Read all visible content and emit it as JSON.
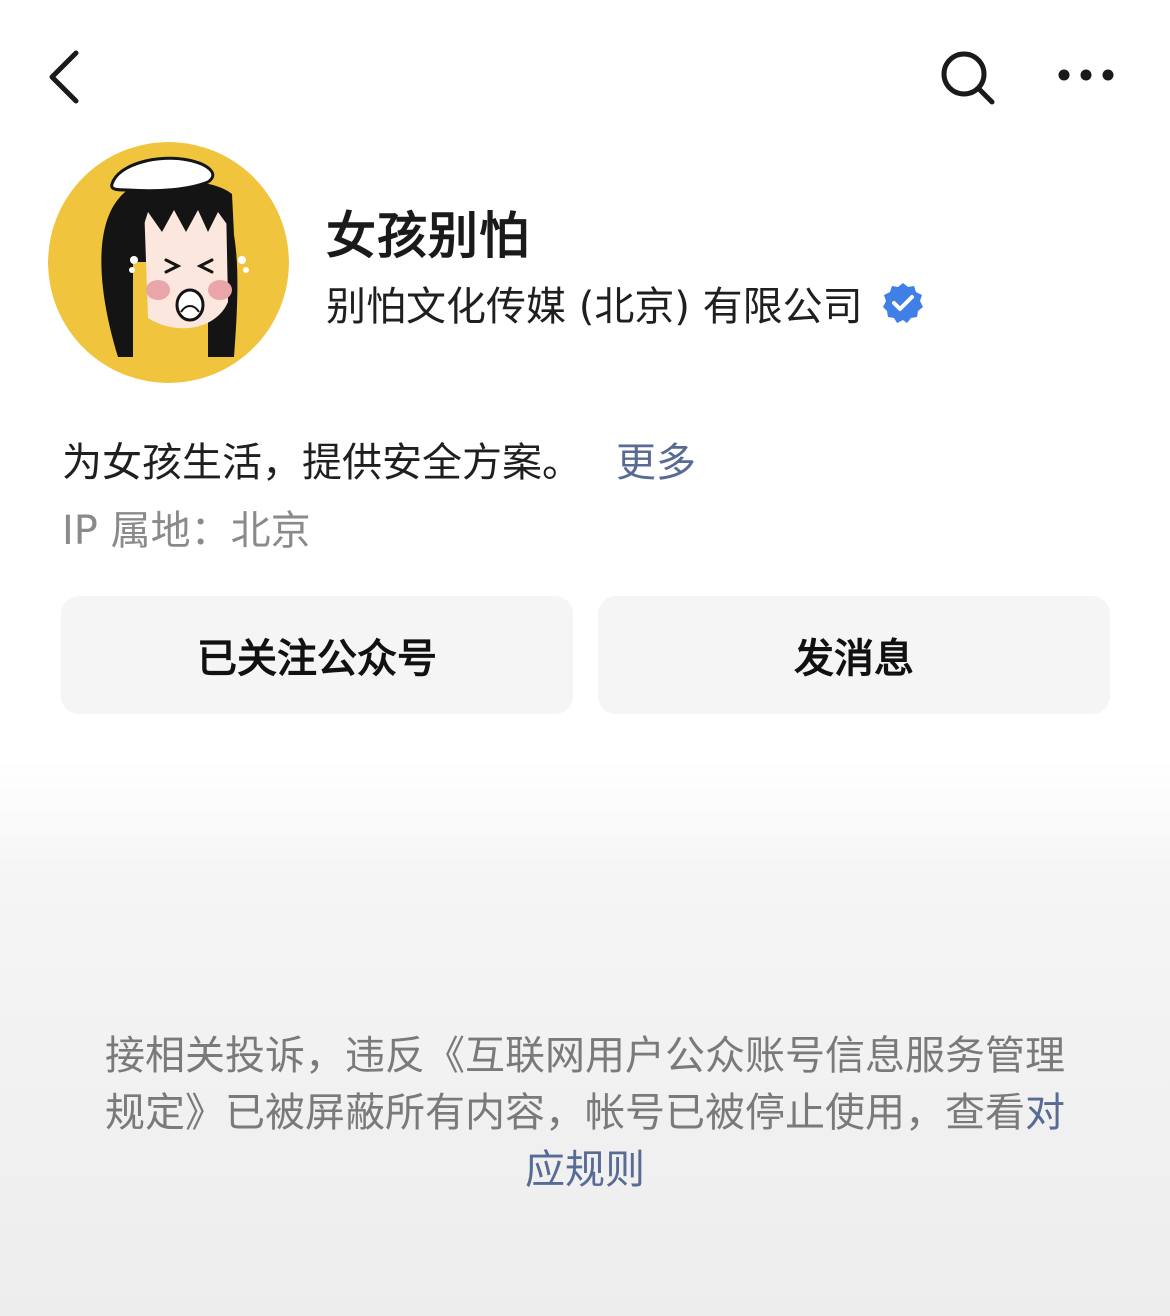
{
  "nav": {
    "back_icon": "chevron-left-icon",
    "search_icon": "search-icon",
    "more_icon": "ellipsis-icon"
  },
  "profile": {
    "avatar_icon": "cartoon-girl-avatar",
    "avatar_bg_color": "#f0c53d",
    "name": "女孩别怕",
    "company": "别怕文化传媒 (北京) 有限公司",
    "verified_icon": "verified-badge-icon",
    "verified_color": "#3f7fe6"
  },
  "intro": {
    "text": "为女孩生活，提供安全方案。",
    "more_label": "更多"
  },
  "ip": {
    "text": "IP 属地：北京"
  },
  "actions": {
    "follow_label": "已关注公众号",
    "message_label": "发消息"
  },
  "notice": {
    "text": "接相关投诉，违反《互联网用户公众账号信息服务管理规定》已被屏蔽所有内容，帐号已被停止使用，查看",
    "link_label": "对应规则",
    "link_color": "#576b95"
  }
}
